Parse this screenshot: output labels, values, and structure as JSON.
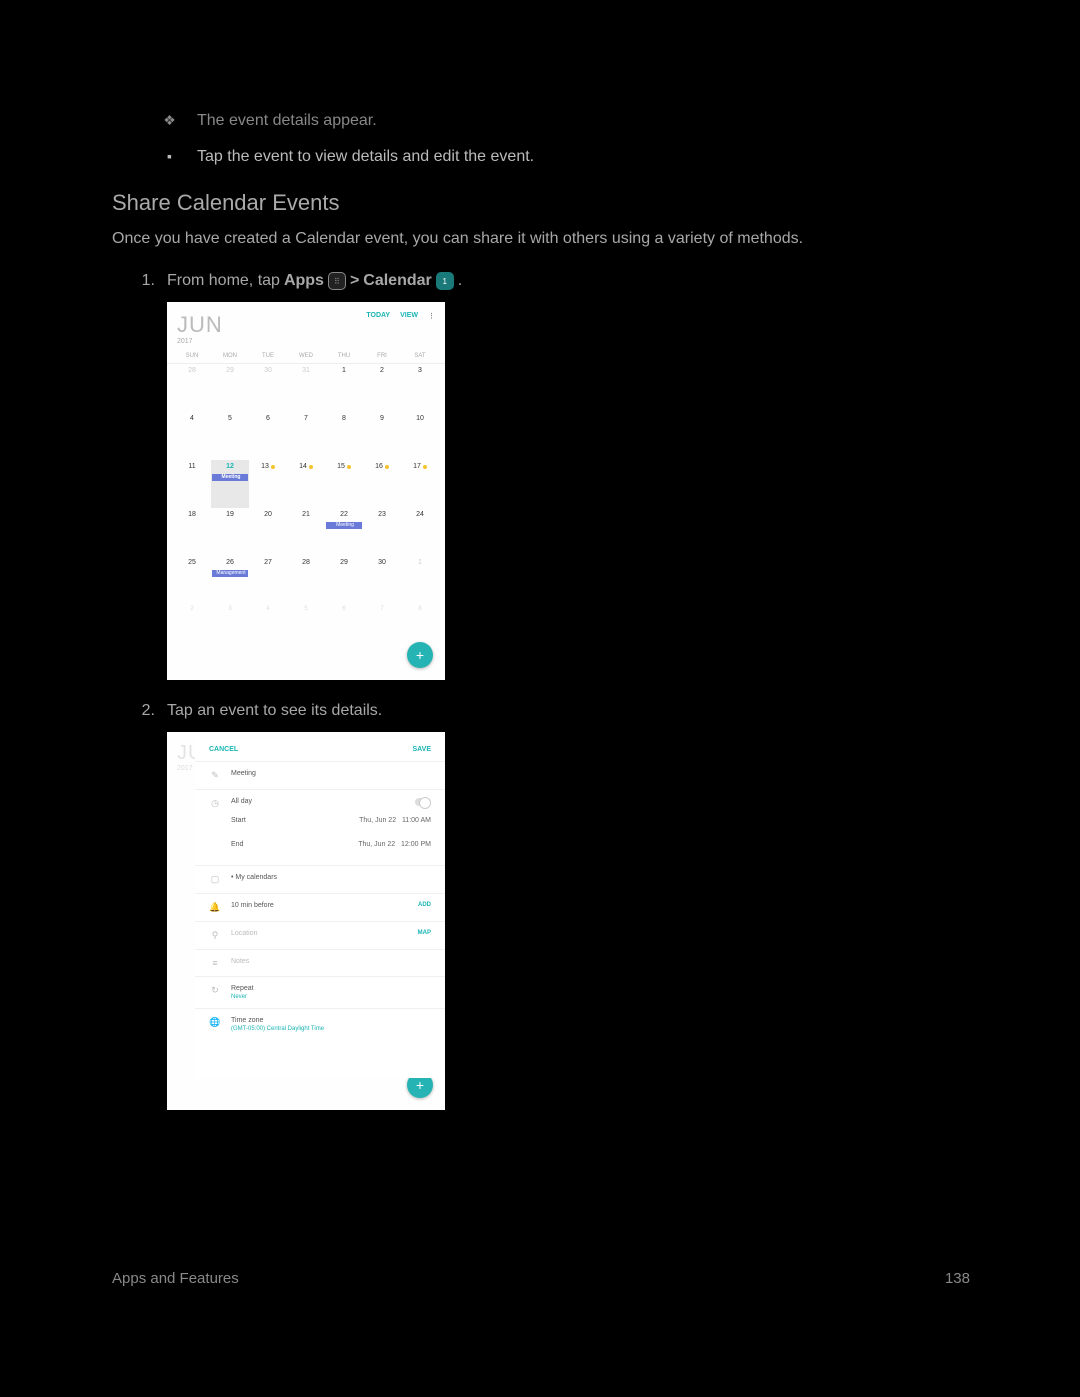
{
  "bullets": {
    "b1": "The event details appear.",
    "b2": "Tap the event to view details and edit the event."
  },
  "heading": "Share Calendar Events",
  "intro": "Once you have created a Calendar event, you can share it with others using a variety of methods.",
  "step1": {
    "num": "1.",
    "a": "From home, tap ",
    "apps": "Apps",
    "sep": " > ",
    "cal": "Calendar",
    "end": "."
  },
  "step2": {
    "num": "2.",
    "txt": "Tap an event to see its details."
  },
  "calendar": {
    "month": "JUN",
    "year": "2017",
    "today": "TODAY",
    "view": "VIEW",
    "dow": [
      "SUN",
      "MON",
      "TUE",
      "WED",
      "THU",
      "FRI",
      "SAT"
    ],
    "rows": [
      [
        {
          "n": "28",
          "o": true
        },
        {
          "n": "29",
          "o": true
        },
        {
          "n": "30",
          "o": true
        },
        {
          "n": "31",
          "o": true
        },
        {
          "n": "1"
        },
        {
          "n": "2"
        },
        {
          "n": "3"
        }
      ],
      [
        {
          "n": "4"
        },
        {
          "n": "5"
        },
        {
          "n": "6"
        },
        {
          "n": "7"
        },
        {
          "n": "8"
        },
        {
          "n": "9"
        },
        {
          "n": "10"
        }
      ],
      [
        {
          "n": "11"
        },
        {
          "n": "12",
          "today": true,
          "ev": "Meeting"
        },
        {
          "n": "13",
          "d": "y"
        },
        {
          "n": "14",
          "d": "y"
        },
        {
          "n": "15",
          "d": "y"
        },
        {
          "n": "16",
          "d": "y"
        },
        {
          "n": "17",
          "d": "y"
        }
      ],
      [
        {
          "n": "18"
        },
        {
          "n": "19"
        },
        {
          "n": "20"
        },
        {
          "n": "21"
        },
        {
          "n": "22",
          "ev": "Meeting"
        },
        {
          "n": "23"
        },
        {
          "n": "24"
        }
      ],
      [
        {
          "n": "25"
        },
        {
          "n": "26",
          "ev": "Management"
        },
        {
          "n": "27"
        },
        {
          "n": "28"
        },
        {
          "n": "29"
        },
        {
          "n": "30"
        },
        {
          "n": "1",
          "o": true
        }
      ]
    ],
    "trail": [
      "2",
      "3",
      "4",
      "5",
      "6",
      "7",
      "8"
    ],
    "fab": "+"
  },
  "detail": {
    "peek_month": "JU",
    "peek_year": "2017",
    "cancel": "CANCEL",
    "save": "SAVE",
    "title": "Meeting",
    "allday": "All day",
    "start_l": "Start",
    "start_d": "Thu, Jun 22",
    "start_t": "11:00 AM",
    "end_l": "End",
    "end_d": "Thu, Jun 22",
    "end_t": "12:00 PM",
    "mycal": "• My calendars",
    "remind": "10 min before",
    "add": "ADD",
    "location": "Location",
    "map": "MAP",
    "notes": "Notes",
    "repeat": "Repeat",
    "repeat_v": "Never",
    "tz": "Time zone",
    "tz_v": "(GMT-05:00) Central Daylight Time"
  },
  "footer": {
    "section": "Apps and Features",
    "page": "138"
  }
}
